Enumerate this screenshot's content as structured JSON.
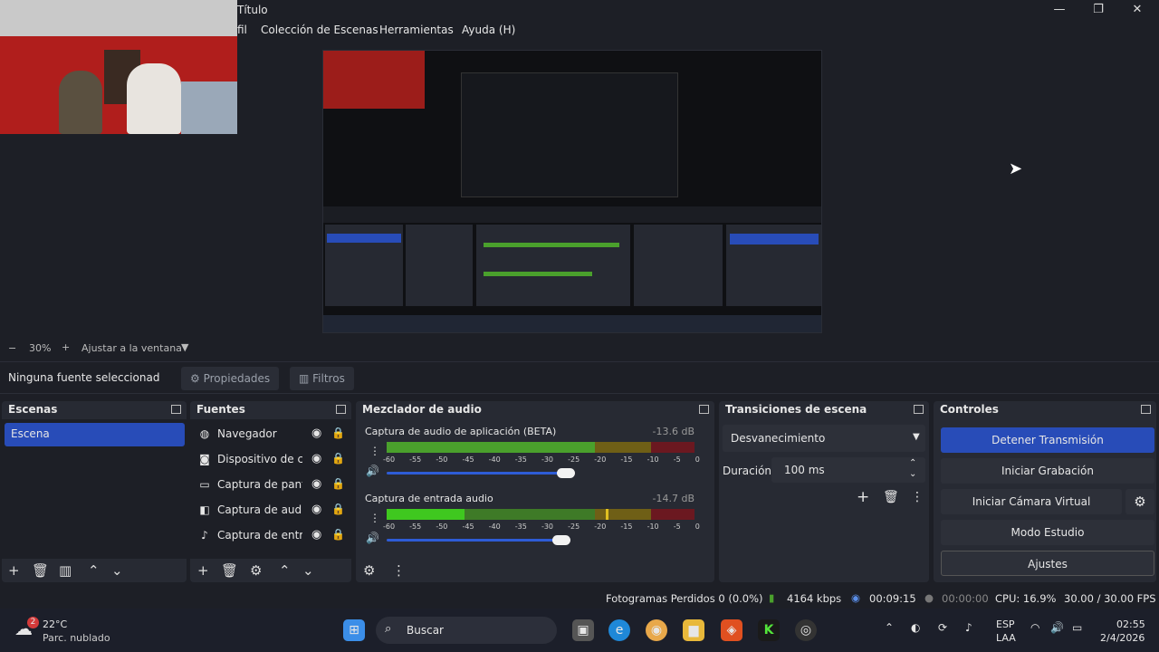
{
  "window": {
    "title": "Título",
    "min_icon": "minimize-icon",
    "max_icon": "maximize-icon",
    "close_icon": "close-icon"
  },
  "menu": [
    "fil",
    "Colección de Escenas",
    "Herramientas",
    "Ayuda (H)"
  ],
  "zoom": {
    "value": "30%",
    "fit_label": "Ajustar a la ventana",
    "minus": "−",
    "plus": "+"
  },
  "source_toolbar": {
    "no_source": "Ninguna fuente seleccionad",
    "properties": "Propiedades",
    "filters": "Filtros"
  },
  "scenes": {
    "title": "Escenas",
    "items": [
      "Escena"
    ]
  },
  "sources": {
    "title": "Fuentes",
    "items": [
      {
        "icon": "browser-icon",
        "label": "Navegador"
      },
      {
        "icon": "camera-icon",
        "label": "Dispositivo de ca"
      },
      {
        "icon": "monitor-icon",
        "label": "Captura de pant"
      },
      {
        "icon": "speaker-icon",
        "label": "Captura de audi"
      },
      {
        "icon": "microphone-icon",
        "label": "Captura de entra"
      }
    ]
  },
  "mixer": {
    "title": "Mezclador de audio",
    "channels": [
      {
        "name": "Captura de audio de aplicación (BETA)",
        "db": "-13.6 dB",
        "level": 0.31
      },
      {
        "name": "Captura de entrada audio",
        "db": "-14.7 dB",
        "level": 0.22
      }
    ],
    "ticks": [
      "-60",
      "-55",
      "-50",
      "-45",
      "-40",
      "-35",
      "-30",
      "-25",
      "-20",
      "-15",
      "-10",
      "-5",
      "0"
    ]
  },
  "transitions": {
    "title": "Transiciones de escena",
    "selected": "Desvanecimiento",
    "duration_label": "Duración",
    "duration": "100 ms"
  },
  "controls": {
    "title": "Controles",
    "stop_stream": "Detener Transmisión",
    "start_rec": "Iniciar Grabación",
    "virtual_cam": "Iniciar Cámara Virtual",
    "studio": "Modo Estudio",
    "settings": "Ajustes"
  },
  "status": {
    "dropped": "Fotogramas Perdidos 0 (0.0%)",
    "bitrate": "4164 kbps",
    "stream_time": "00:09:15",
    "rec_time": "00:00:00",
    "cpu": "CPU: 16.9%",
    "fps": "30.00 / 30.00 FPS"
  },
  "taskbar": {
    "temp": "22°C",
    "weather": "Parc. nublado",
    "badge": "2",
    "search": "Buscar",
    "lang1": "ESP",
    "lang2": "LAA",
    "time": "02:55",
    "date": "2/4/2026"
  },
  "colors": {
    "accent": "#284cb8",
    "panel": "#272a33",
    "bg": "#1d1f26"
  }
}
